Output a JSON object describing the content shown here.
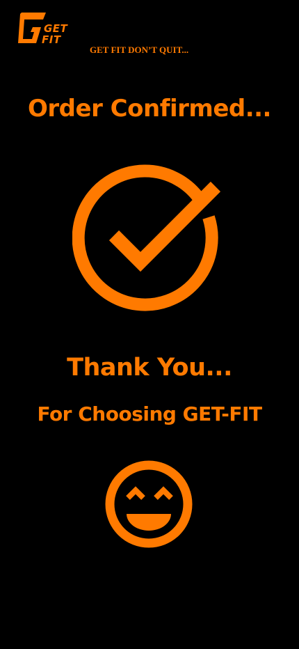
{
  "brand": {
    "logo_line1": "GET",
    "logo_line2": "FIT",
    "tagline": "GET FIT DON’T QUIT..."
  },
  "confirmation": {
    "title": "Order Confirmed...",
    "thanks": "Thank You...",
    "subtitle": "For Choosing GET-FIT"
  },
  "icons": {
    "status": "check-circle-icon",
    "emoji": "smiling-face-icon"
  },
  "colors": {
    "accent": "#ff7a00",
    "background": "#000000"
  }
}
